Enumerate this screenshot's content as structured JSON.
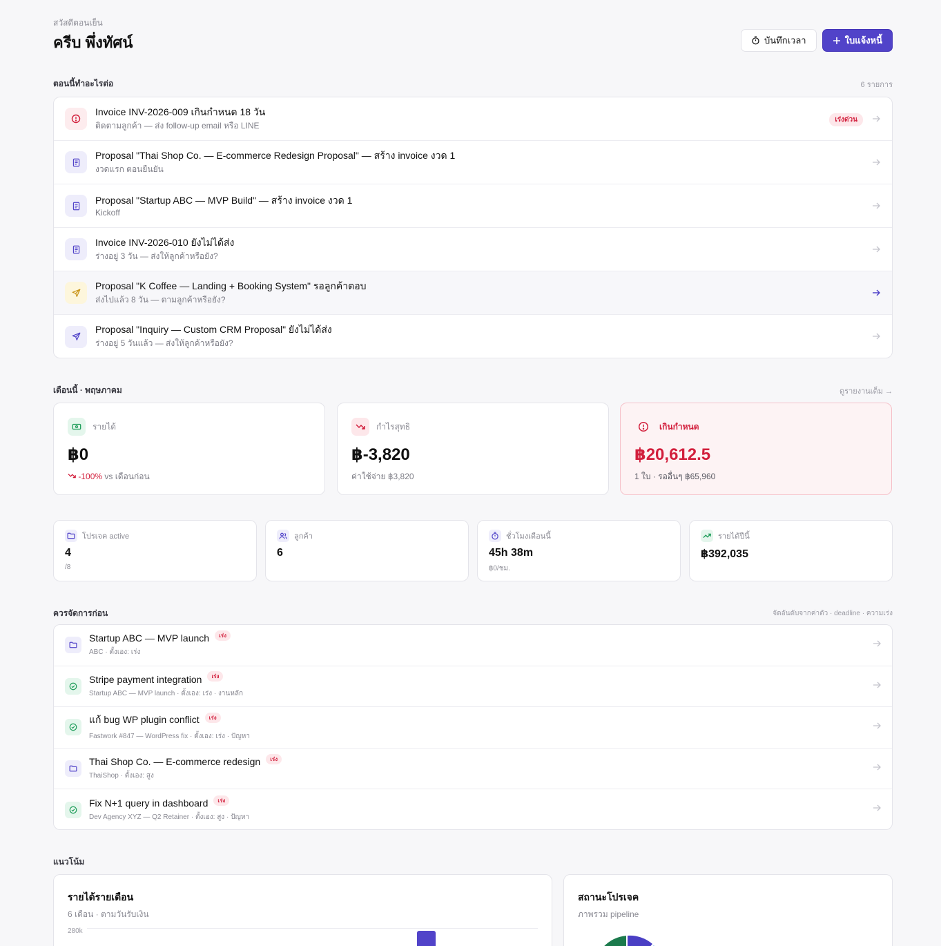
{
  "header": {
    "greeting": "สวัสดีตอนเย็น",
    "user_name": "ครีบ พึ่งทัศน์",
    "time_button": "บันทึกเวลา",
    "invoice_button": "ใบแจ้งหนี้"
  },
  "next_actions": {
    "title": "ตอนนี้ทำอะไรต่อ",
    "count": "6 รายการ",
    "urgent_label": "เร่งด่วน",
    "items": [
      {
        "title": "Invoice INV-2026-009 เกินกำหนด 18 วัน",
        "sub": "ติดตามลูกค้า — ส่ง follow-up email หรือ LINE",
        "icon": "alert-circle-icon"
      },
      {
        "title": "Proposal \"Thai Shop Co. — E-commerce Redesign Proposal\" — สร้าง invoice งวด 1",
        "sub": "งวดแรก ตอนยืนยัน",
        "icon": "document-icon"
      },
      {
        "title": "Proposal \"Startup ABC — MVP Build\" — สร้าง invoice งวด 1",
        "sub": "Kickoff",
        "icon": "document-icon"
      },
      {
        "title": "Invoice INV-2026-010 ยังไม่ได้ส่ง",
        "sub": "ร่างอยู่ 3 วัน — ส่งให้ลูกค้าหรือยัง?",
        "icon": "document-icon"
      },
      {
        "title": "Proposal \"K Coffee — Landing + Booking System\" รอลูกค้าตอบ",
        "sub": "ส่งไปแล้ว 8 วัน — ตามลูกค้าหรือยัง?",
        "icon": "send-icon"
      },
      {
        "title": "Proposal \"Inquiry — Custom CRM Proposal\" ยังไม่ได้ส่ง",
        "sub": "ร่างอยู่ 5 วันแล้ว — ส่งให้ลูกค้าหรือยัง?",
        "icon": "send-icon"
      }
    ]
  },
  "month": {
    "title": "เดือนนี้ · พฤษภาคม",
    "full_report": "ดูรายงานเต็ม →",
    "revenue": {
      "label": "รายได้",
      "value": "฿0",
      "change": "-100%",
      "change_suffix": "vs เดือนก่อน"
    },
    "profit": {
      "label": "กำไรสุทธิ",
      "value": "฿-3,820",
      "sub": "ค่าใช้จ่าย ฿3,820"
    },
    "overdue": {
      "label": "เกินกำหนด",
      "value": "฿20,612.5",
      "sub": "1 ใบ · รออื่นๆ ฿65,960"
    }
  },
  "kpis": [
    {
      "label": "โปรเจค active",
      "value": "4",
      "sub": "/8",
      "icon": "folder-icon"
    },
    {
      "label": "ลูกค้า",
      "value": "6",
      "sub": "",
      "icon": "users-icon"
    },
    {
      "label": "ชั่วโมงเดือนนี้",
      "value": "45h 38m",
      "sub": "฿0/ชม.",
      "icon": "timer-icon"
    },
    {
      "label": "รายได้ปีนี้",
      "value": "฿392,035",
      "sub": "",
      "icon": "trending-up-icon"
    }
  ],
  "priorities": {
    "title": "ควรจัดการก่อน",
    "sort_note": "จัดอันดับจากค่าตัว · deadline · ความเร่ง",
    "badge": "เร่ง",
    "items": [
      {
        "title": "Startup ABC — MVP launch",
        "sub": "ABC · ตั้งเอง: เร่ง",
        "icon": "folder-icon"
      },
      {
        "title": "Stripe payment integration",
        "sub": "Startup ABC — MVP launch · ตั้งเอง: เร่ง · งานหลัก",
        "icon": "check-circle-icon"
      },
      {
        "title": "แก้ bug WP plugin conflict",
        "sub": "Fastwork #847 — WordPress fix · ตั้งเอง: เร่ง · ปัญหา",
        "icon": "check-circle-icon"
      },
      {
        "title": "Thai Shop Co. — E-commerce redesign",
        "sub": "ThaiShop · ตั้งเอง: สูง",
        "icon": "folder-icon"
      },
      {
        "title": "Fix N+1 query in dashboard",
        "sub": "Dev Agency XYZ — Q2 Retainer · ตั้งเอง: สูง · ปัญหา",
        "icon": "check-circle-icon"
      }
    ]
  },
  "trends": {
    "title": "แนวโน้ม",
    "revenue_chart": {
      "title": "รายได้รายเดือน",
      "sub": "6 เดือน · ตามวันรับเงิน",
      "tick": "280k"
    },
    "status_chart": {
      "title": "สถานะโปรเจค",
      "sub": "ภาพรวม pipeline"
    }
  },
  "colors": {
    "accent": "#5143c9",
    "danger": "#d21f3c",
    "success": "#1f9d5a"
  }
}
